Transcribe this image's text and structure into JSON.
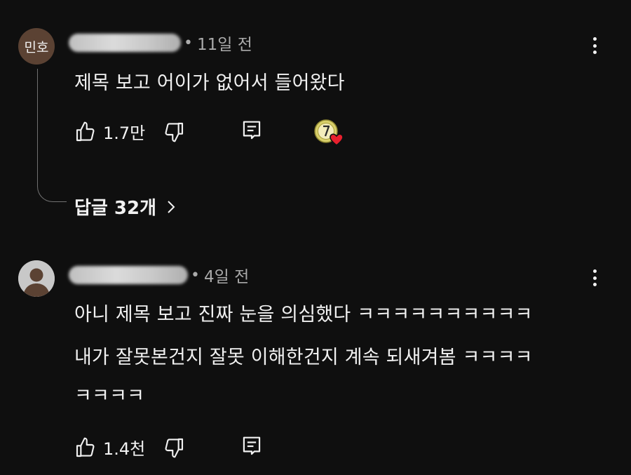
{
  "comments": [
    {
      "avatar_initials": "민호",
      "timestamp": "11일 전",
      "text_lines": [
        "제목 보고 어이가 없어서 들어왔다"
      ],
      "likes": "1.7만",
      "creator_heart": true,
      "replies_label": "답글 32개"
    },
    {
      "avatar_initials": "",
      "timestamp": "4일 전",
      "text_lines": [
        "아니 제목 보고 진짜 눈을 의심했다 ㅋㅋㅋㅋㅋㅋㅋㅋㅋㅋ",
        "내가 잘못본건지 잘못 이해한건지 계속 되새겨봄 ㅋㅋㅋㅋ",
        "ㅋㅋㅋㅋ"
      ],
      "likes": "1.4천"
    }
  ],
  "separator": "•",
  "colors": {
    "background": "#0f0f0f",
    "text": "#f1f1f1",
    "muted": "#aaaaaa",
    "heart": "#e8202e",
    "avatar_brown": "#5b4233"
  },
  "icons": [
    "like-icon",
    "dislike-icon",
    "reply-icon",
    "more-vert-icon",
    "chevron-right-icon",
    "creator-heart-icon"
  ]
}
